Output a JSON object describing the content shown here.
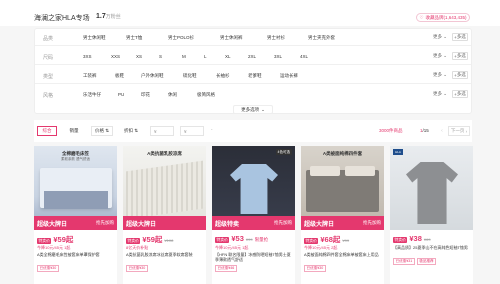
{
  "header": {
    "store_name": "海澜之家HLA专场",
    "fans_count": "1.7",
    "fans_unit": "万粉丝",
    "fav_label": "收藏品牌(1,643,435)"
  },
  "filters": {
    "rows": [
      {
        "label": "品类",
        "options": [
          "男士休闲鞋",
          "男士T恤",
          "男士POLO衫",
          "男士休闲裤",
          "男士衬衫",
          "男士夹克外套"
        ],
        "more": "更多",
        "multi": "多选"
      },
      {
        "label": "尺码",
        "options": [
          "3XS",
          "XXS",
          "XS",
          "S",
          "M",
          "L",
          "XL",
          "2XL",
          "3XL",
          "4XL"
        ],
        "more": "更多",
        "multi": "多选"
      },
      {
        "label": "类型",
        "options": [
          "工装裤",
          "板鞋",
          "户外休闲鞋",
          "硫化鞋",
          "长袖衫",
          "老爹鞋",
          "运动长裤"
        ],
        "more": "更多",
        "multi": "多选"
      },
      {
        "label": "风格",
        "options": [
          "乐活牛仔",
          "PU",
          "印花",
          "休闲",
          "极简风格"
        ],
        "more": "更多",
        "multi": "多选"
      }
    ],
    "more_options": "更多选项"
  },
  "sort": {
    "buttons": [
      "综合",
      "销量",
      "价格",
      "折扣"
    ],
    "price_min_placeholder": "¥",
    "price_max_placeholder": "¥",
    "dash": "-",
    "result_count": "3000件商品",
    "page": "1",
    "total_pages": "/15",
    "next_label": "下一页"
  },
  "products": [
    {
      "thumb_title": "全棉磨毛床笠",
      "thumb_sub": "柔软亲肤 透气舒适",
      "thumb_tag": "",
      "banner_big": "超级大牌日",
      "banner_small": "抢先加购",
      "badge": "特卖价",
      "price": "¥59起",
      "orig": "",
      "price_note": "",
      "sub_line": "今降10元/45元 1起",
      "desc": "A类全棉磨毛床笠被套床单罩保护套",
      "tags": [
        "已优惠¥30"
      ]
    },
    {
      "thumb_title": "A类抗菌乳胶凉席",
      "thumb_sub": "",
      "thumb_tag": "",
      "banner_big": "超级大牌日",
      "banner_small": "",
      "badge": "特卖价",
      "price": "¥59起",
      "orig": "¥108",
      "price_note": "",
      "sub_line": "8亿天价补贴",
      "desc": "A类抗菌乳胶凉席冰丝席夏季软席套装",
      "tags": [
        "已优惠¥30"
      ]
    },
    {
      "thumb_title": "",
      "thumb_sub": "",
      "thumb_tag": "4色可选",
      "banner_big": "超级特卖",
      "banner_small": "抢先加购",
      "badge": "特卖价",
      "price": "¥53",
      "orig": "¥99",
      "price_note": "限量抢",
      "sub_line": "今降10元/45元 1起",
      "desc": "【HFN 联名限量】冰感防晒短袖T恤男士夏季薄款透气舒适",
      "tags": [
        "已优惠¥46"
      ]
    },
    {
      "thumb_title": "A类被面纯棉四件套",
      "thumb_sub": "",
      "thumb_tag": "",
      "banner_big": "超级大牌日",
      "banner_small": "抢先加购",
      "badge": "特卖价",
      "price": "¥68起",
      "orig": "¥99",
      "price_note": "",
      "sub_line": "今降10元/45元 2起",
      "desc": "A类被面纯棉四件套全棉床单被套床上用品",
      "tags": [
        "已优惠¥30"
      ]
    },
    {
      "thumb_title": "",
      "thumb_sub": "",
      "thumb_tag": "",
      "banner_big": "",
      "banner_small": "",
      "badge": "特卖价",
      "price": "¥38",
      "orig": "¥69",
      "price_note": "",
      "sub_line": "",
      "desc": "【高品质】25夏季山不在高纯色短袖T恤男",
      "tags": [
        "已优惠¥31",
        "极品推荐"
      ]
    }
  ]
}
